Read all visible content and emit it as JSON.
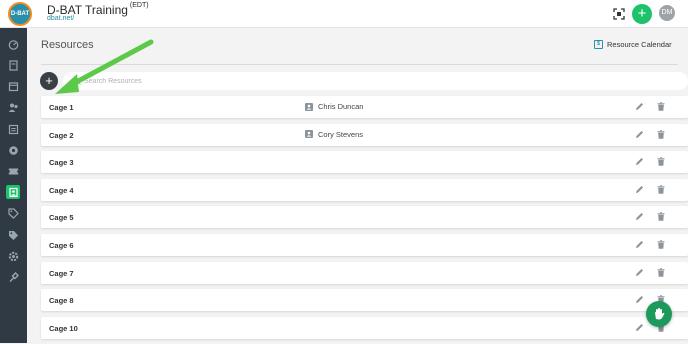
{
  "header": {
    "logo_text": "D-BAT",
    "title": "D-BAT Training",
    "timezone": "(EDT)",
    "link": "dbat.net/",
    "add_icon": "plus-icon",
    "qr_icon": "qr-scan-icon",
    "avatar_initials": "DM"
  },
  "sidebar": {
    "items": [
      {
        "icon": "dashboard-icon"
      },
      {
        "icon": "book-icon"
      },
      {
        "icon": "calendar-icon"
      },
      {
        "icon": "users-icon"
      },
      {
        "icon": "list-icon"
      },
      {
        "icon": "gauge-icon"
      },
      {
        "icon": "ticket-icon"
      },
      {
        "icon": "resource-icon",
        "active": true
      },
      {
        "icon": "tag-icon"
      },
      {
        "icon": "price-tag-icon"
      },
      {
        "icon": "settings-icon"
      },
      {
        "icon": "tools-icon"
      }
    ]
  },
  "main": {
    "title": "Resources",
    "calendar_link": "Resource Calendar",
    "search_placeholder": "Search Resources"
  },
  "resources": [
    {
      "name": "Cage 1",
      "assignee": "Chris Duncan"
    },
    {
      "name": "Cage 2",
      "assignee": "Cory Stevens"
    },
    {
      "name": "Cage 3",
      "assignee": ""
    },
    {
      "name": "Cage 4",
      "assignee": ""
    },
    {
      "name": "Cage 5",
      "assignee": ""
    },
    {
      "name": "Cage 6",
      "assignee": ""
    },
    {
      "name": "Cage 7",
      "assignee": ""
    },
    {
      "name": "Cage 8",
      "assignee": ""
    },
    {
      "name": "Cage 10",
      "assignee": ""
    }
  ],
  "colors": {
    "accent_green": "#1ec26b",
    "brand_teal": "#2a8fa8",
    "sidebar_bg": "#2f3a44",
    "annotation_arrow": "#5cc94a"
  }
}
